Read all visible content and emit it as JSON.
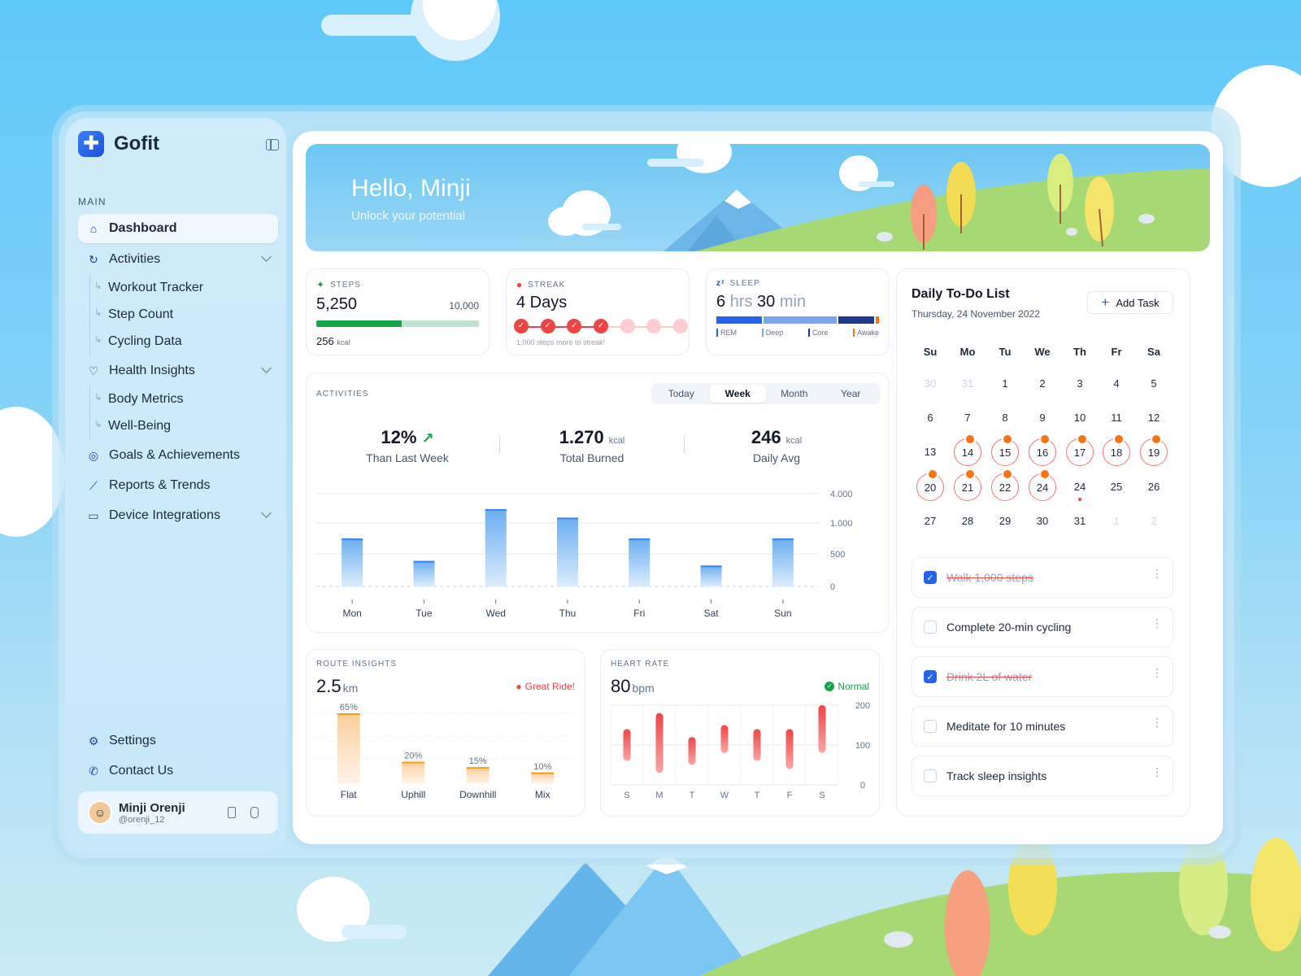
{
  "brand": {
    "name": "Gofit"
  },
  "sidebar": {
    "section_label": "MAIN",
    "items": [
      {
        "label": "Dashboard",
        "icon": "home-icon",
        "active": true
      },
      {
        "label": "Activities",
        "icon": "activity-icon",
        "children": [
          "Workout Tracker",
          "Step Count",
          "Cycling Data"
        ]
      },
      {
        "label": "Health Insights",
        "icon": "heart-pulse-icon",
        "children": [
          "Body Metrics",
          "Well-Being"
        ]
      },
      {
        "label": "Goals & Achievements",
        "icon": "target-icon"
      },
      {
        "label": "Reports & Trends",
        "icon": "chart-line-icon"
      },
      {
        "label": "Device Integrations",
        "icon": "devices-icon"
      }
    ],
    "bottom": [
      {
        "label": "Settings",
        "icon": "gear-icon"
      },
      {
        "label": "Contact Us",
        "icon": "phone-icon"
      }
    ],
    "user": {
      "name": "Minji Orenji",
      "handle": "@orenji_12"
    }
  },
  "banner": {
    "greeting": "Hello, Minji",
    "subtitle": "Unlock your potential"
  },
  "stats": {
    "steps": {
      "label": "STEPS",
      "value": "5,250",
      "goal": "10,000",
      "kcal": "256",
      "kcal_unit": "kcal",
      "progress": 0.525
    },
    "streak": {
      "label": "STREAK",
      "value": "4 Days",
      "hint": "1,000 steps more to streak!",
      "done": 4,
      "total": 7
    },
    "sleep": {
      "label": "SLEEP",
      "hrs": "6",
      "hrs_unit": "hrs",
      "min": "30",
      "min_unit": "min",
      "legend": [
        "REM",
        "Deep",
        "Core",
        "Awake"
      ],
      "colors": [
        "#2563eb",
        "#7aa7ea",
        "#1e3a8a",
        "#f97316"
      ],
      "segments": [
        0.29,
        0.46,
        0.23,
        0.02
      ]
    }
  },
  "activities": {
    "label": "ACTIVITIES",
    "tabs": [
      "Today",
      "Week",
      "Month",
      "Year"
    ],
    "active_tab": "Week",
    "kpis": [
      {
        "value": "12%",
        "unit": "",
        "label": "Than Last Week"
      },
      {
        "value": "1.270",
        "unit": "kcal",
        "label": "Total Burned"
      },
      {
        "value": "246",
        "unit": "kcal",
        "label": "Daily Avg"
      }
    ]
  },
  "route": {
    "label": "ROUTE INSIGHTS",
    "value": "2.5",
    "unit": "km",
    "badge": "Great Ride!"
  },
  "heart": {
    "label": "HEART RATE",
    "value": "80",
    "unit": "bpm",
    "badge": "Normal"
  },
  "todo": {
    "title": "Daily To-Do List",
    "date": "Thursday, 24 November 2022",
    "add_label": "Add Task",
    "weekdays": [
      "Su",
      "Mo",
      "Tu",
      "We",
      "Th",
      "Fr",
      "Sa"
    ],
    "days": [
      [
        "30",
        "31",
        "1",
        "2",
        "3",
        "4",
        "5"
      ],
      [
        "6",
        "7",
        "8",
        "9",
        "10",
        "11",
        "12"
      ],
      [
        "13",
        "14",
        "15",
        "16",
        "17",
        "18",
        "19"
      ],
      [
        "20",
        "21",
        "22",
        "24",
        "24",
        "25",
        "26"
      ],
      [
        "27",
        "28",
        "29",
        "30",
        "31",
        "1",
        "2"
      ]
    ],
    "tasks": [
      {
        "label": "Walk 1,000 steps",
        "done": true
      },
      {
        "label": "Complete 20-min cycling",
        "done": false
      },
      {
        "label": "Drink 2L of water",
        "done": true
      },
      {
        "label": "Meditate for 10 minutes",
        "done": false
      },
      {
        "label": "Track sleep insights",
        "done": false
      }
    ]
  },
  "chart_data": [
    {
      "type": "bar",
      "title": "",
      "categories": [
        "Mon",
        "Tue",
        "Wed",
        "Thu",
        "Fri",
        "Sat",
        "Sun"
      ],
      "values": [
        620,
        330,
        1000,
        890,
        620,
        270,
        620
      ],
      "yticks": [
        "4.000",
        "1.000",
        "500",
        "0"
      ],
      "ylim": [
        0,
        1200
      ]
    },
    {
      "type": "bar",
      "title": "",
      "categories": [
        "Flat",
        "Uphill",
        "Downhill",
        "Mix"
      ],
      "values": [
        65,
        20,
        15,
        10
      ],
      "data_labels": [
        "65%",
        "20%",
        "15%",
        "10%"
      ],
      "ylim": [
        0,
        65
      ]
    },
    {
      "type": "bar",
      "title": "",
      "categories": [
        "S",
        "M",
        "T",
        "W",
        "T",
        "F",
        "S"
      ],
      "ranges": [
        [
          60,
          140
        ],
        [
          30,
          180
        ],
        [
          50,
          120
        ],
        [
          80,
          150
        ],
        [
          60,
          140
        ],
        [
          40,
          140
        ],
        [
          80,
          200
        ]
      ],
      "yticks": [
        "200",
        "100",
        "0"
      ],
      "ylim": [
        0,
        200
      ]
    }
  ]
}
